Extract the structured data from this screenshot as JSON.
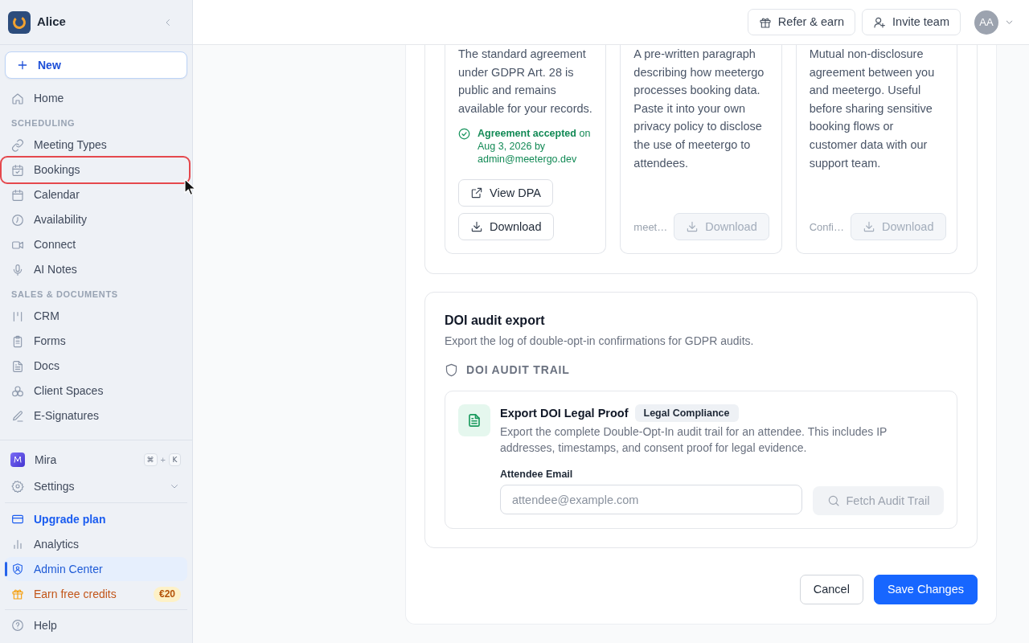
{
  "sidebar": {
    "workspace": "Alice",
    "new_button": "New",
    "nav": [
      {
        "kind": "link",
        "label": "Home",
        "selected": false,
        "highlighted": false
      },
      {
        "kind": "section",
        "label": "SCHEDULING"
      },
      {
        "kind": "link",
        "label": "Meeting Types",
        "selected": false,
        "highlighted": false
      },
      {
        "kind": "link",
        "label": "Bookings",
        "selected": false,
        "highlighted": true
      },
      {
        "kind": "link",
        "label": "Calendar",
        "selected": false,
        "highlighted": false
      },
      {
        "kind": "link",
        "label": "Availability",
        "selected": false,
        "highlighted": false
      },
      {
        "kind": "link",
        "label": "Connect",
        "selected": false,
        "highlighted": false
      },
      {
        "kind": "link",
        "label": "AI Notes",
        "selected": false,
        "highlighted": false
      },
      {
        "kind": "section",
        "label": "SALES & DOCUMENTS"
      },
      {
        "kind": "link",
        "label": "CRM",
        "selected": false,
        "highlighted": false
      },
      {
        "kind": "link",
        "label": "Forms",
        "selected": false,
        "highlighted": false
      },
      {
        "kind": "link",
        "label": "Docs",
        "selected": false,
        "highlighted": false
      },
      {
        "kind": "link",
        "label": "Client Spaces",
        "selected": false,
        "highlighted": false
      },
      {
        "kind": "link",
        "label": "E-Signatures",
        "selected": false,
        "highlighted": false
      }
    ],
    "bottom_groups": [
      [
        {
          "kind": "assistant",
          "label": "Mira",
          "selected": false,
          "shortcut": {
            "keys": [
              "⌘",
              "K"
            ],
            "joiner": "+"
          }
        },
        {
          "kind": "menu",
          "label": "Settings",
          "selected": false,
          "expanded": false
        }
      ],
      [
        {
          "kind": "upgrade",
          "label": "Upgrade plan",
          "selected": false
        },
        {
          "kind": "link",
          "label": "Analytics",
          "selected": false
        },
        {
          "kind": "link",
          "label": "Admin Center",
          "selected": true
        },
        {
          "kind": "reward",
          "label": "Earn free credits",
          "selected": false,
          "badge": "€20"
        }
      ],
      [
        {
          "kind": "link",
          "label": "Help",
          "selected": false
        }
      ]
    ]
  },
  "topbar": {
    "buttons": [
      {
        "kind": "gift",
        "label": "Refer & earn"
      },
      {
        "kind": "invite",
        "label": "Invite team"
      }
    ],
    "avatar": "AA"
  },
  "agreements": {
    "cards": [
      {
        "description": "The standard agreement under GDPR Art. 28 is public and remains available for your records.",
        "status": "**Agreement accepted** on Aug 3, 2026 by admin@meetergo.dev",
        "actions": [
          {
            "kind": "open",
            "label": "View DPA",
            "disabled": false
          },
          {
            "kind": "download",
            "label": "Download",
            "disabled": false
          }
        ]
      },
      {
        "description": "A pre-written paragraph describing how meetergo processes booking data. Paste it into your own privacy policy to disclose the use of meetergo to attendees.",
        "file": "meet…",
        "actions": [
          {
            "kind": "download",
            "label": "Download",
            "disabled": true
          }
        ]
      },
      {
        "description": "Mutual non-disclosure agreement between you and meetergo. Useful before sharing sensitive booking flows or customer data with our support team.",
        "file": "Confi…",
        "actions": [
          {
            "kind": "download",
            "label": "Download",
            "disabled": true
          }
        ]
      }
    ]
  },
  "doi_audit": {
    "title": "DOI audit export",
    "subtitle": "Export the log of double-opt-in confirmations for GDPR audits.",
    "section_label": "DOI AUDIT TRAIL",
    "tool": {
      "title": "Export DOI Legal Proof",
      "badge": "Legal Compliance",
      "description": "Export the complete Double-Opt-In audit trail for an attendee. This includes IP addresses, timestamps, and consent proof for legal evidence.",
      "field": {
        "label": "Attendee Email",
        "placeholder": "attendee@example.com"
      },
      "button": {
        "label": "Fetch Audit Trail",
        "disabled": true
      }
    }
  },
  "footer": {
    "buttons": [
      {
        "kind": "secondary",
        "label": "Cancel"
      },
      {
        "kind": "primary",
        "label": "Save Changes"
      }
    ]
  }
}
